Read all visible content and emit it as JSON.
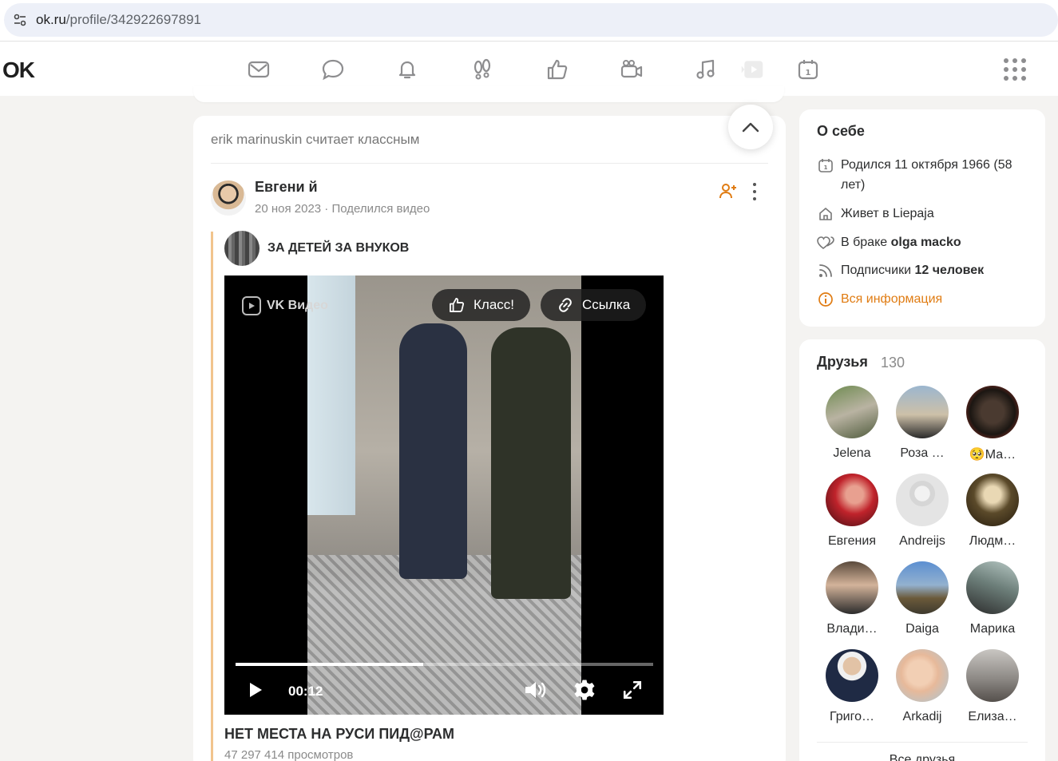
{
  "browser": {
    "url_host": "ok.ru",
    "url_path": "/profile/342922697891"
  },
  "header": {
    "logo": "OK"
  },
  "feed": {
    "liked_by": "erik marinuskin считает классным",
    "author_name": "Евгени й",
    "author_meta": "20 ноя 2023 · Поделился видео",
    "group_name": "ЗА ДЕТЕЙ ЗА ВНУКОВ",
    "video": {
      "brand": "VK Видео",
      "like_label": "Класс!",
      "link_label": "Ссылка",
      "time": "00:12",
      "progress": 0.45
    },
    "video_title": "НЕТ МЕСТА НА РУСИ ПИД@РАМ",
    "views": "47 297 414 просмотров"
  },
  "about": {
    "title": "О себе",
    "born": "Родился 11 октября 1966 (58 лет)",
    "lives_prefix": "Живет в ",
    "lives_city": "Liepaja",
    "married_prefix": "В браке ",
    "married_name": "olga macko",
    "subs_prefix": "Подписчики ",
    "subs_count": "12 человек",
    "all_info": "Вся информация",
    "accent": "#e07c13"
  },
  "friends": {
    "title": "Друзья",
    "count": "130",
    "items": [
      {
        "name": "Jelena"
      },
      {
        "name": "Роза …"
      },
      {
        "name": "🥺Ма…"
      },
      {
        "name": "Евгения"
      },
      {
        "name": "Andreijs"
      },
      {
        "name": "Людм…"
      },
      {
        "name": "Влади…"
      },
      {
        "name": "Daiga"
      },
      {
        "name": "Марика"
      },
      {
        "name": "Григо…"
      },
      {
        "name": "Arkadij"
      },
      {
        "name": "Елиза…"
      }
    ],
    "all_label": "Все друзья"
  }
}
